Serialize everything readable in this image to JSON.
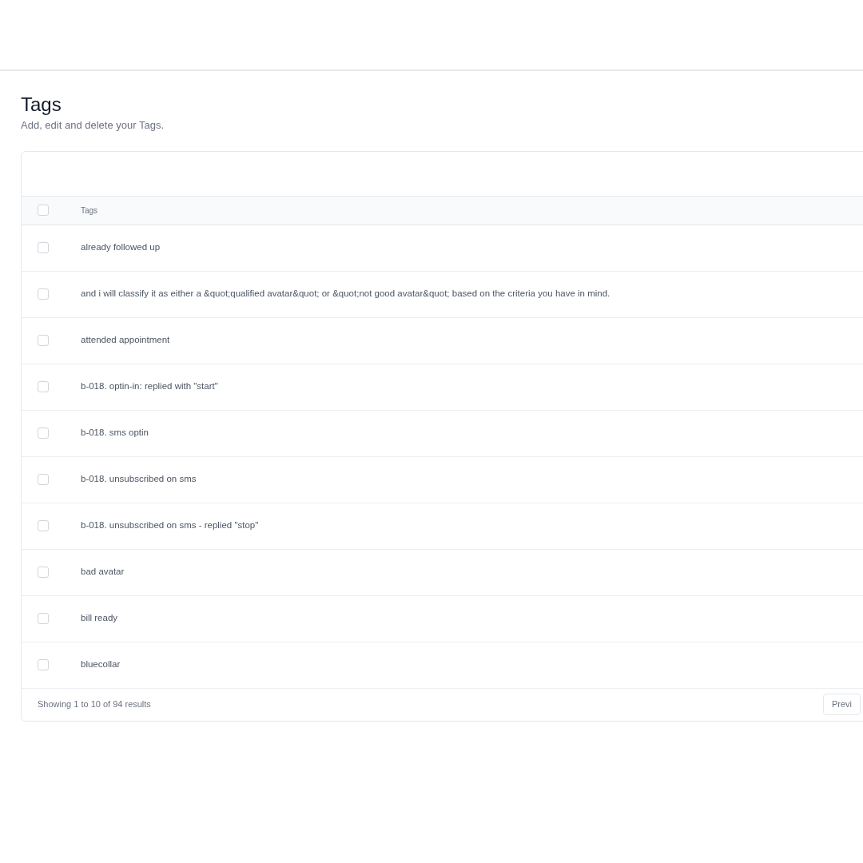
{
  "page": {
    "title": "Tags",
    "subtitle": "Add, edit and delete your Tags."
  },
  "table": {
    "header": {
      "label": "Tags",
      "checked": false
    },
    "rows": [
      {
        "tag": "already followed up",
        "checked": false
      },
      {
        "tag": "and i will classify it as either a &quot;qualified avatar&quot; or &quot;not good avatar&quot; based on the criteria you have in mind.",
        "checked": false
      },
      {
        "tag": "attended appointment",
        "checked": false
      },
      {
        "tag": "b-018. optin-in: replied with \"start\"",
        "checked": false
      },
      {
        "tag": "b-018. sms optin",
        "checked": false
      },
      {
        "tag": "b-018. unsubscribed on sms",
        "checked": false
      },
      {
        "tag": "b-018. unsubscribed on sms - replied \"stop\"",
        "checked": false
      },
      {
        "tag": "bad avatar",
        "checked": false
      },
      {
        "tag": "bill ready",
        "checked": false
      },
      {
        "tag": "bluecollar",
        "checked": false
      }
    ]
  },
  "footer": {
    "summary": "Showing 1 to 10 of 94 results",
    "previous": "Previ"
  }
}
